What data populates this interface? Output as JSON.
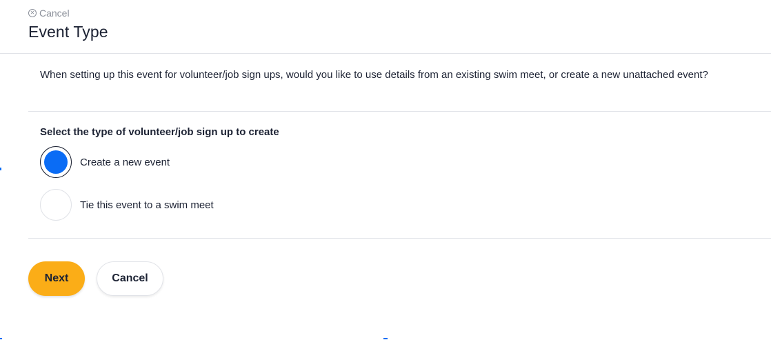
{
  "header": {
    "cancel_label": "Cancel",
    "cancel_icon": "close-circle-icon",
    "title": "Event Type"
  },
  "intro_text": "When setting up this event for volunteer/job sign ups, would you like to use details from an existing swim meet, or create a new unattached event?",
  "section": {
    "label": "Select the type of volunteer/job sign up to create",
    "options": [
      {
        "label": "Create a new event",
        "selected": true
      },
      {
        "label": "Tie this event to a swim meet",
        "selected": false
      }
    ]
  },
  "actions": {
    "next_label": "Next",
    "cancel_label": "Cancel"
  },
  "colors": {
    "accent": "#0a6cf5",
    "primary_button": "#fbad17",
    "text": "#1c2233",
    "muted": "#8a8f99",
    "divider": "#e1e3e8"
  }
}
